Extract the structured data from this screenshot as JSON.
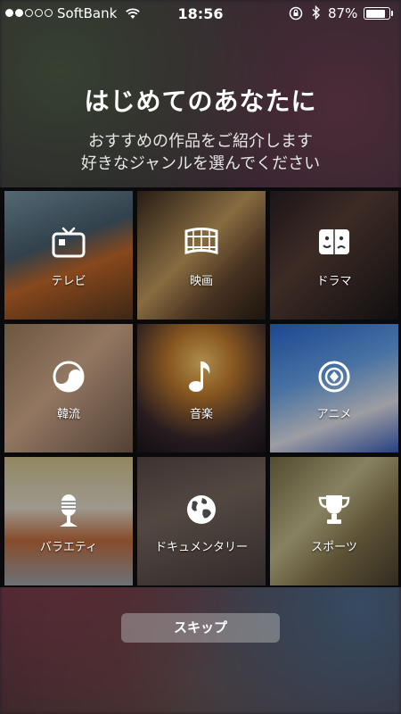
{
  "status_bar": {
    "carrier": "SoftBank",
    "time": "18:56",
    "battery_percent": "87%",
    "signal_strength_of_5": 2,
    "battery_level_percent": 87
  },
  "header": {
    "title": "はじめてのあなたに",
    "subtitle_line1": "おすすめの作品をご紹介します",
    "subtitle_line2": "好きなジャンルを選んでください"
  },
  "genres": [
    {
      "label": "テレビ",
      "icon": "tv-icon"
    },
    {
      "label": "映画",
      "icon": "film-icon"
    },
    {
      "label": "ドラマ",
      "icon": "drama-masks-icon"
    },
    {
      "label": "韓流",
      "icon": "korean-yinyang-icon"
    },
    {
      "label": "音楽",
      "icon": "music-note-icon"
    },
    {
      "label": "アニメ",
      "icon": "anime-icon"
    },
    {
      "label": "バラエティ",
      "icon": "microphone-icon"
    },
    {
      "label": "ドキュメンタリー",
      "icon": "globe-icon"
    },
    {
      "label": "スポーツ",
      "icon": "trophy-icon"
    }
  ],
  "skip_button": "スキップ",
  "colors": {
    "skip_button_bg": "#bebebe",
    "grid_bg": "#0a0a0c"
  }
}
